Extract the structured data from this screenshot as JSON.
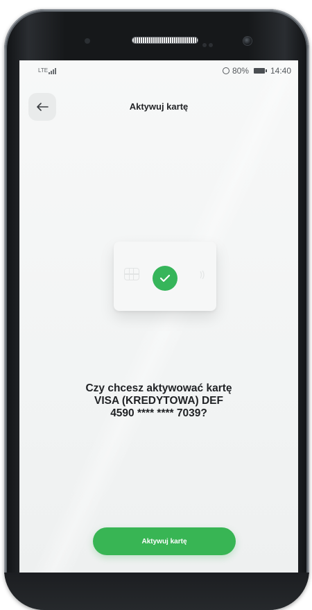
{
  "status_bar": {
    "network": "LTE",
    "battery_percent": "80%",
    "time": "14:40"
  },
  "header": {
    "title": "Aktywuj kartę",
    "back_icon": "arrow-left-icon"
  },
  "illustration": {
    "icons": [
      "chip-icon",
      "check-circle-icon",
      "contactless-icon"
    ],
    "accent": "#36b55a"
  },
  "question": {
    "line1": "Czy chcesz aktywować kartę",
    "line2": "VISA (KREDYTOWA) DEF",
    "line3": "4590 **** **** 7039?"
  },
  "actions": {
    "activate_label": "Aktywuj kartę",
    "button_color": "#38b554"
  }
}
